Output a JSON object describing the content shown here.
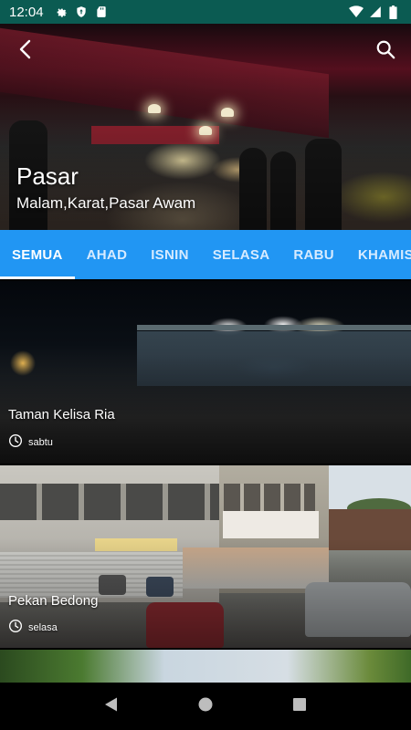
{
  "status_bar": {
    "time": "12:04"
  },
  "header": {
    "title": "Pasar",
    "subtitle": "Malam,Karat,Pasar Awam"
  },
  "tabs": [
    {
      "label": "SEMUA",
      "active": true
    },
    {
      "label": "AHAD",
      "active": false
    },
    {
      "label": "ISNIN",
      "active": false
    },
    {
      "label": "SELASA",
      "active": false
    },
    {
      "label": "RABU",
      "active": false
    },
    {
      "label": "KHAMIS",
      "active": false
    }
  ],
  "cards": [
    {
      "title": "Taman Kelisa Ria",
      "day": "sabtu"
    },
    {
      "title": "Pekan Bedong",
      "day": "selasa"
    }
  ],
  "colors": {
    "status_bar": "#0b5b52",
    "tab_bar": "#2196f3",
    "nav_bar": "#000000"
  },
  "icons": {
    "status_left": [
      "gear-icon",
      "shield-icon",
      "sd-card-icon"
    ],
    "status_right": [
      "wifi-icon",
      "signal-icon",
      "battery-icon"
    ],
    "header": [
      "back-arrow-icon",
      "search-icon"
    ],
    "card_day": "clock-icon",
    "nav": [
      "nav-back-icon",
      "nav-home-icon",
      "nav-recents-icon"
    ]
  }
}
